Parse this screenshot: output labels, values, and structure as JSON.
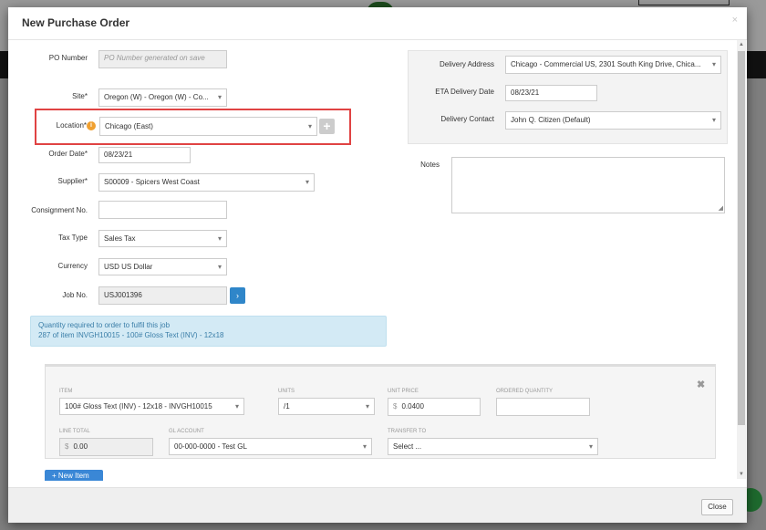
{
  "modal": {
    "title": "New Purchase Order",
    "close_glyph": "×"
  },
  "form": {
    "po_number": {
      "label": "PO Number",
      "placeholder": "PO Number generated on save"
    },
    "site": {
      "label": "Site*",
      "value": "Oregon (W) - Oregon (W) - Co..."
    },
    "location": {
      "label": "Location*",
      "value": "Chicago (East)",
      "add_glyph": "+"
    },
    "order_date": {
      "label": "Order Date*",
      "value": "08/23/21"
    },
    "supplier": {
      "label": "Supplier*",
      "value": "S00009 - Spicers West Coast"
    },
    "consignment": {
      "label": "Consignment No.",
      "value": ""
    },
    "tax_type": {
      "label": "Tax Type",
      "value": "Sales Tax"
    },
    "currency": {
      "label": "Currency",
      "value": "USD US Dollar"
    },
    "job_no": {
      "label": "Job No.",
      "value": "USJ001396",
      "button_glyph": "›"
    }
  },
  "alert": {
    "line1": "Quantity required to order to fulfil this job",
    "line2": "287 of item INVGH10015 - 100# Gloss Text (INV) - 12x18"
  },
  "delivery": {
    "address_label": "Delivery Address",
    "address_value": "Chicago - Commercial US, 2301 South King Drive, Chica...",
    "eta_label": "ETA Delivery Date",
    "eta_value": "08/23/21",
    "contact_label": "Delivery Contact",
    "contact_value": "John Q. Citizen (Default)"
  },
  "notes": {
    "label": "Notes",
    "value": ""
  },
  "line_item": {
    "item_label": "Item",
    "item_value": "100# Gloss Text (INV) - 12x18 - INVGH10015",
    "units_label": "Units",
    "units_value": "/1",
    "unit_price_label": "Unit Price",
    "unit_price_value": "0.0400",
    "ordered_qty_label": "Ordered Quantity",
    "ordered_qty_value": "",
    "line_total_label": "Line Total",
    "line_total_value": "0.00",
    "gl_account_label": "GL Account",
    "gl_account_value": "00-000-0000 - Test GL",
    "transfer_label": "Transfer To",
    "transfer_value": "Select ...",
    "currency_symbol": "$",
    "remove_glyph": "✖"
  },
  "new_item_button": "+ New Item",
  "footer": {
    "close_label": "Close"
  },
  "colors": {
    "accent": "#2f86c9",
    "highlight": "#e04343",
    "info": "#f0a030"
  }
}
